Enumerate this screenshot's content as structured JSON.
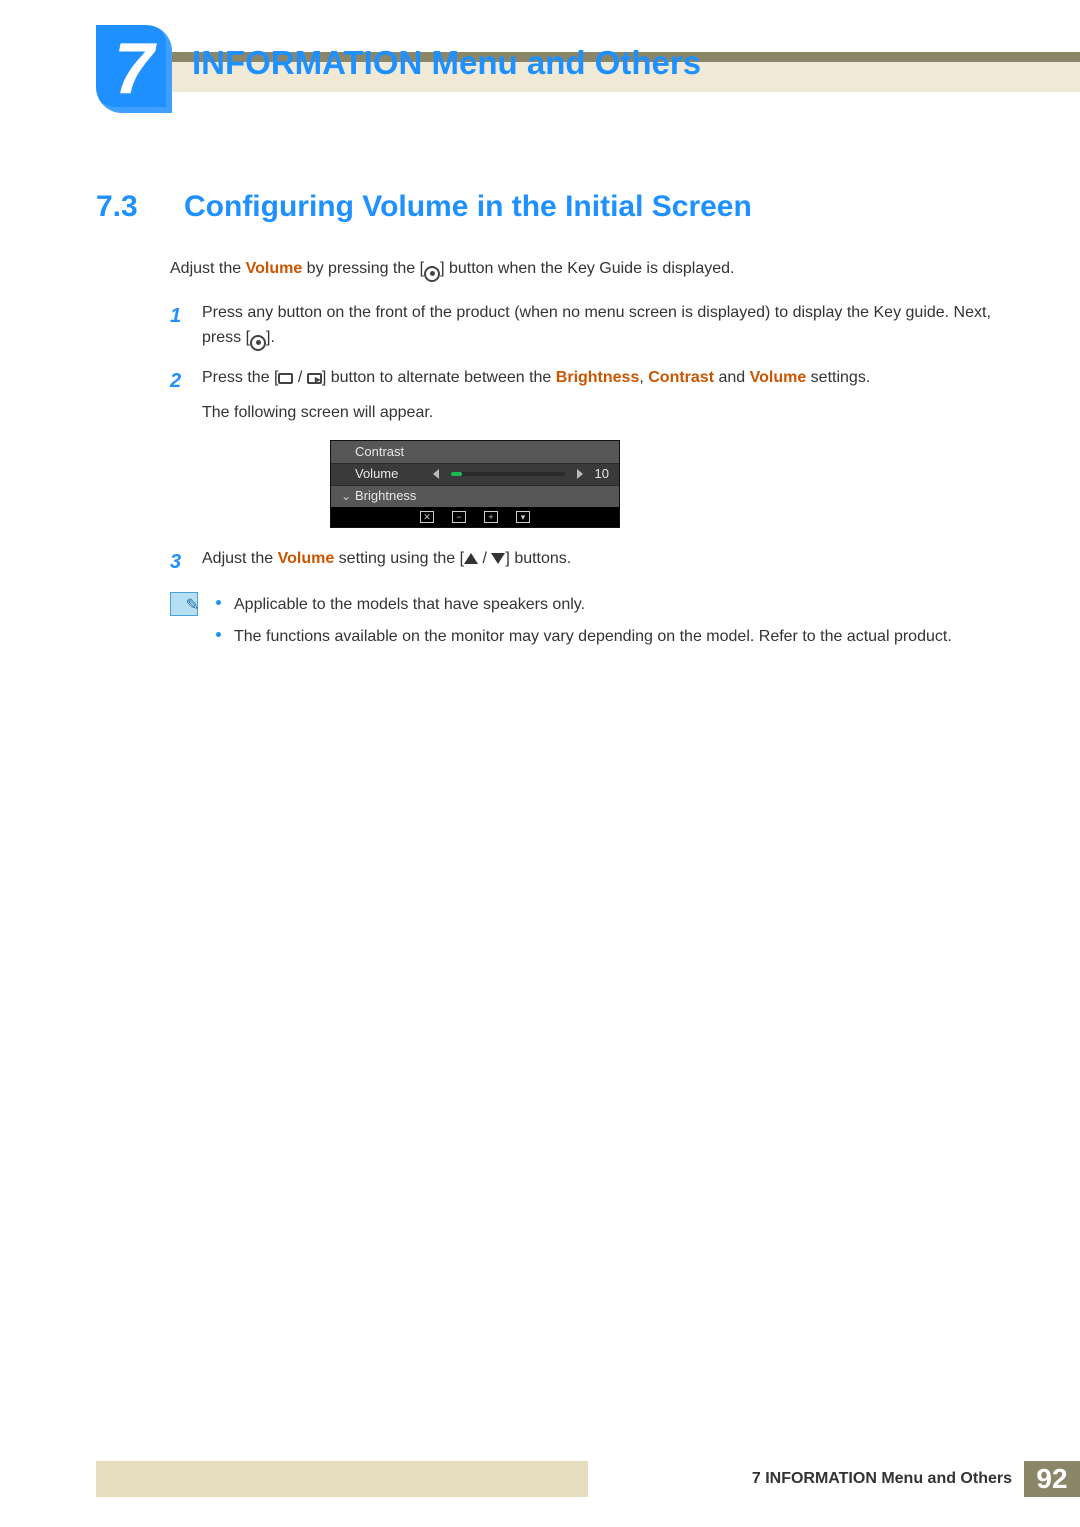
{
  "chapter": {
    "number": "7",
    "title": "INFORMATION Menu and Others"
  },
  "section": {
    "number": "7.3",
    "title": "Configuring Volume in the Initial Screen"
  },
  "intro": {
    "pre": "Adjust the ",
    "hl": "Volume",
    "mid": " by pressing the [",
    "post": "] button when the Key Guide is displayed."
  },
  "steps": [
    {
      "n": "1",
      "a": "Press any button on the front of the product (when no menu screen is displayed) to display the Key guide. Next, press [",
      "b": "]."
    },
    {
      "n": "2",
      "a": "Press the [",
      "b": "] button to alternate between the ",
      "hl1": "Brightness",
      "c": ", ",
      "hl2": "Contrast",
      "d": " and ",
      "hl3": "Volume",
      "e": " settings.",
      "tail": "The following screen will appear."
    },
    {
      "n": "3",
      "a": "Adjust the ",
      "hl": "Volume",
      "b": " setting using the [",
      "c": "] buttons."
    }
  ],
  "osd": {
    "contrast": "Contrast",
    "volume": "Volume",
    "brightness": "Brightness",
    "value": "10"
  },
  "notes": [
    "Applicable to the models that have speakers only.",
    "The functions available on the monitor may vary depending on the model. Refer to the actual product."
  ],
  "footer": {
    "text": "7 INFORMATION Menu and Others",
    "page": "92"
  }
}
